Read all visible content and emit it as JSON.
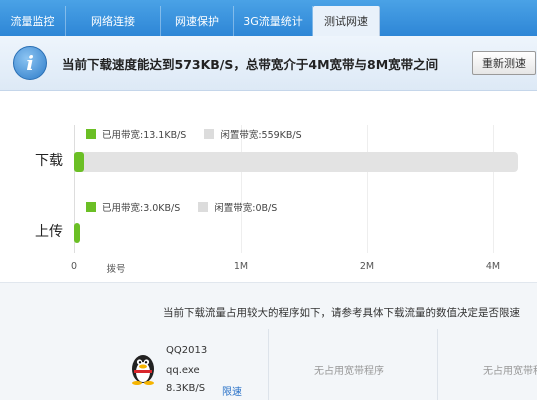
{
  "tabs": [
    {
      "label": "流量监控",
      "active": false
    },
    {
      "label": "网络连接",
      "active": false
    },
    {
      "label": "网速保护",
      "active": false
    },
    {
      "label": "3G流量统计",
      "active": false
    },
    {
      "label": "测试网速",
      "active": true
    }
  ],
  "banner": {
    "icon": "info-icon",
    "icon_glyph": "i",
    "message": "当前下载速度能达到573KB/S，总带宽介于4M宽带与8M宽带之间",
    "retest_label": "重新测速"
  },
  "chart_data": {
    "type": "bar",
    "orientation": "horizontal",
    "unit_axis": [
      "0",
      "拨号",
      "1M",
      "2M",
      "4M"
    ],
    "rows": [
      {
        "name": "下载",
        "used_label": "已用带宽:13.1KB/S",
        "free_label": "闲置带宽:559KB/S",
        "used_kbs": 13.1,
        "free_kbs": 559
      },
      {
        "name": "上传",
        "used_label": "已用带宽:3.0KB/S",
        "free_label": "闲置带宽:0B/S",
        "used_kbs": 3.0,
        "free_kbs": 0
      }
    ],
    "colors": {
      "used": "#6bbf25",
      "free": "#dcdcdc"
    }
  },
  "bottom": {
    "message": "当前下载流量占用较大的程序如下，请参考具体下载流量的数值决定是否限速",
    "apps": [
      {
        "name": "QQ2013",
        "process": "qq.exe",
        "speed": "8.3KB/S",
        "action": "限速",
        "icon": "qq-penguin-icon"
      }
    ],
    "empty_slots": [
      "无占用宽带程序",
      "无占用宽带程序"
    ]
  }
}
